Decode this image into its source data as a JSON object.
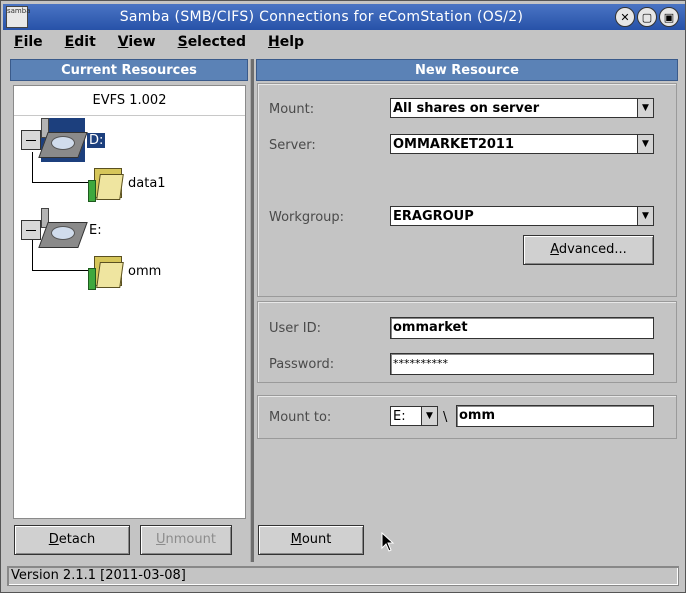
{
  "window": {
    "title": "Samba (SMB/CIFS) Connections for eComStation (OS/2)",
    "app_icon_text": "samba",
    "controls": [
      "close-icon",
      "minimize-icon",
      "maximize-icon"
    ]
  },
  "menu": [
    {
      "label": "File",
      "mnemonic": "F",
      "rest": "ile"
    },
    {
      "label": "Edit",
      "mnemonic": "E",
      "rest": "dit"
    },
    {
      "label": "View",
      "mnemonic": "V",
      "rest": "iew"
    },
    {
      "label": "Selected",
      "mnemonic": "S",
      "rest": "elected"
    },
    {
      "label": "Help",
      "mnemonic": "H",
      "rest": "elp"
    }
  ],
  "current_resources": {
    "header": "Current Resources",
    "tree_title": "EVFS 1.002",
    "drives": [
      {
        "label": "D:",
        "selected": true,
        "shares": [
          "data1"
        ]
      },
      {
        "label": "E:",
        "selected": false,
        "shares": [
          "omm"
        ]
      }
    ],
    "detach_label": "Detach",
    "detach_mnemonic": "D",
    "detach_rest": "etach",
    "unmount_label": "Unmount",
    "unmount_mnemonic": "U",
    "unmount_rest": "nmount"
  },
  "new_resource": {
    "header": "New Resource",
    "mount_label": "Mount:",
    "mount_value": "All shares on server",
    "server_label": "Server:",
    "server_value": "OMMARKET2011",
    "workgroup_label": "Workgroup:",
    "workgroup_value": "ERAGROUP",
    "advanced_label": "Advanced...",
    "advanced_mnemonic": "A",
    "advanced_rest": "dvanced...",
    "userid_label": "User ID:",
    "userid_value": "ommarket",
    "password_label": "Password:",
    "password_value": "**********",
    "mountto_label": "Mount to:",
    "mountto_drive": "E:",
    "mountto_sep": "\\",
    "mountto_name": "omm",
    "mount_button_label": "Mount",
    "mount_button_mnemonic": "M",
    "mount_button_rest": "ount"
  },
  "status": "Version 2.1.1 [2011-03-08]",
  "colors": {
    "titlebar": "#2752a8",
    "panel_header": "#5b82b6",
    "selection": "#1c3f7d",
    "window_bg": "#c4c4c4"
  }
}
